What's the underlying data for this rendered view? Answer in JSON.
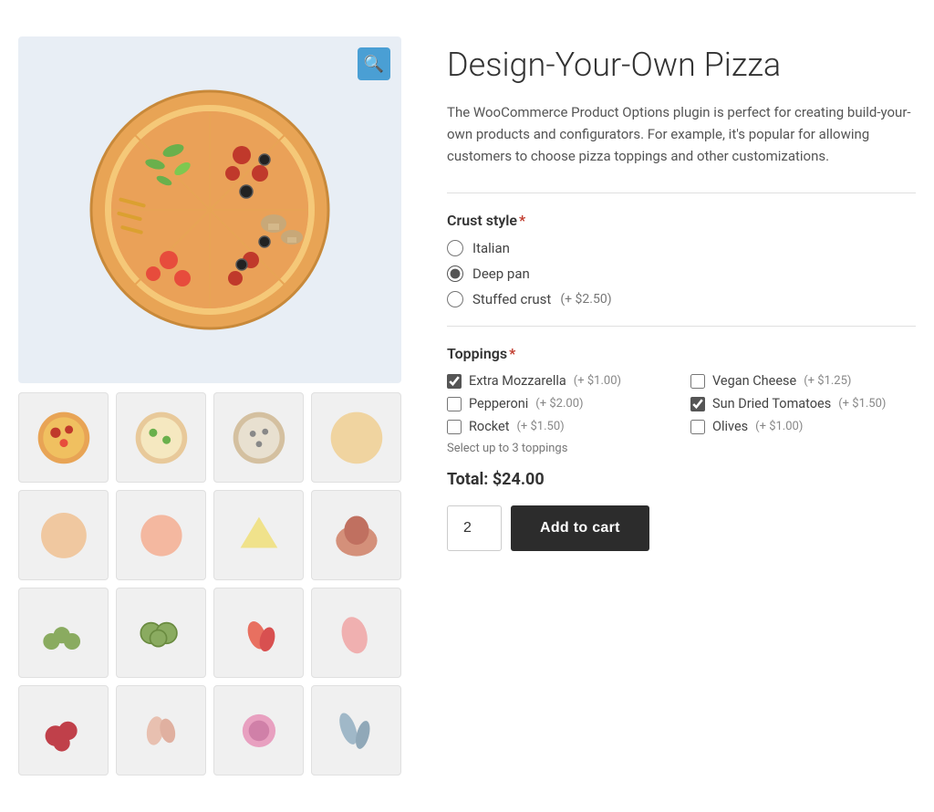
{
  "product": {
    "title": "Design-Your-Own Pizza",
    "description": "The WooCommerce Product Options plugin is perfect for creating build-your-own products and configurators. For example, it's popular for allowing customers to choose pizza toppings and other customizations."
  },
  "crust_section": {
    "label": "Crust style",
    "required": true,
    "options": [
      {
        "id": "italian",
        "label": "Italian",
        "price": null
      },
      {
        "id": "deep_pan",
        "label": "Deep pan",
        "price": null,
        "selected": true
      },
      {
        "id": "stuffed",
        "label": "Stuffed crust",
        "price": "(+ $2.50)"
      }
    ]
  },
  "toppings_section": {
    "label": "Toppings",
    "required": true,
    "hint": "Select up to 3 toppings",
    "options": [
      {
        "id": "extra_mozz",
        "label": "Extra Mozzarella",
        "price": "(+ $1.00)",
        "checked": true
      },
      {
        "id": "vegan_cheese",
        "label": "Vegan Cheese",
        "price": "(+ $1.25)",
        "checked": false
      },
      {
        "id": "pepperoni",
        "label": "Pepperoni",
        "price": "(+ $2.00)",
        "checked": false
      },
      {
        "id": "sun_dried",
        "label": "Sun Dried Tomatoes",
        "price": "(+ $1.50)",
        "checked": true
      },
      {
        "id": "rocket",
        "label": "Rocket",
        "price": "(+ $1.50)",
        "checked": false
      },
      {
        "id": "olives",
        "label": "Olives",
        "price": "(+ $1.00)",
        "checked": false
      }
    ]
  },
  "total": {
    "label": "Total:",
    "amount": "$24.00"
  },
  "cart": {
    "quantity": "2",
    "add_to_cart_label": "Add to cart"
  },
  "zoom_icon": "🔍",
  "colors": {
    "accent_blue": "#4a9fd4",
    "required_red": "#c0392b",
    "dark_btn": "#2c2c2c"
  }
}
